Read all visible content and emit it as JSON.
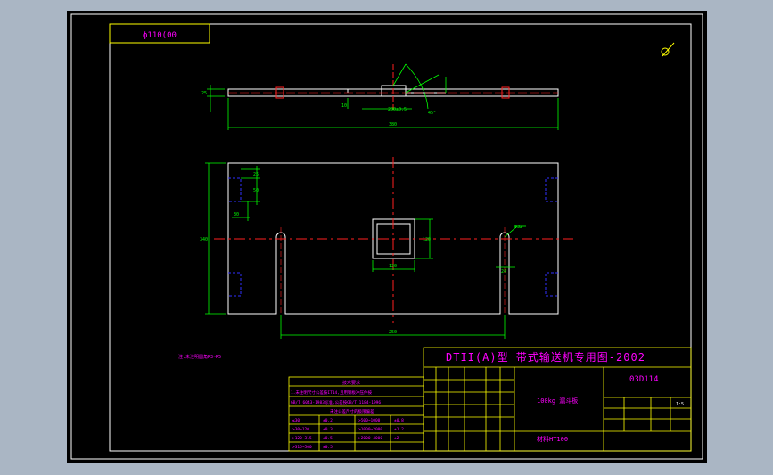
{
  "drawing_tag": "ф110(00",
  "view_symbol": "⊗",
  "title_block": {
    "main_title": "DTII(A)型  带式输送机专用图-2002",
    "drawing_no": "03D114",
    "part_name": "100kg 漏斗板",
    "material": "材料HT100",
    "scale": "1:5"
  },
  "notes": {
    "left_note": "注:未注明圆角R3~R5",
    "tech_header": "技术要求",
    "tech_line1": "1.未注明尺寸公差按IT14,且用钢板冲压件按",
    "tech_line2": "GB/T 6043-1983标准,公差按GB/T 1184-1996",
    "tech_table_header": "未注公差尺寸的极限偏差"
  },
  "tolerance_table": [
    [
      "≤30",
      "±0.2",
      ">500~1000",
      "±0.8"
    ],
    [
      ">30~120",
      "±0.3",
      ">1000~2000",
      "±1.2"
    ],
    [
      ">120~315",
      "±0.5",
      ">2000~4000",
      "±2"
    ],
    [
      ">315~500",
      "±0.5",
      "",
      ""
    ]
  ],
  "dimensions": {
    "top_length": "380",
    "top_height": "25",
    "top_small_left": "10",
    "top_center": "200±0.5",
    "top_angle": "45°",
    "left_height": "340",
    "left_small_a": "25",
    "left_small_b": "50",
    "left_small_c": "30",
    "center_square": "120",
    "center_side": "120",
    "right_hole": "Φ32",
    "right_slot": "24",
    "bottom_width": "250"
  },
  "colors": {
    "background": "#000000",
    "frame": "#ffffff",
    "outline": "#ffffff",
    "dimension": "#00ff00",
    "centerline": "#ff2020",
    "hidden": "#3030ff",
    "text": "#ff00ff",
    "titleblock": "#ffff00"
  }
}
